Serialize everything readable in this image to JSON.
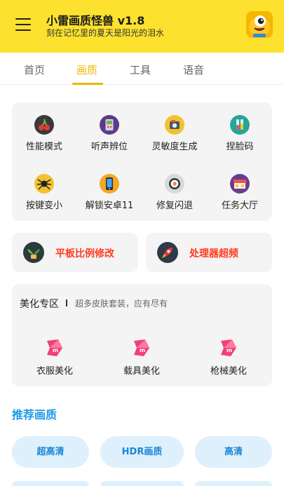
{
  "header": {
    "title": "小雷画质怪兽 v1.8",
    "subtitle": "刻在记忆里的夏天是阳光的泪水"
  },
  "tabs": [
    {
      "label": "首页",
      "active": false
    },
    {
      "label": "画质",
      "active": true
    },
    {
      "label": "工具",
      "active": false
    },
    {
      "label": "语音",
      "active": false
    }
  ],
  "grid": [
    {
      "label": "性能模式",
      "icon": "cherry-icon"
    },
    {
      "label": "听声辨位",
      "icon": "gameboy-icon"
    },
    {
      "label": "灵敏度生成",
      "icon": "camera-icon"
    },
    {
      "label": "捏脸码",
      "icon": "test-tube-icon"
    },
    {
      "label": "按键变小",
      "icon": "spider-icon"
    },
    {
      "label": "解锁安卓11",
      "icon": "phone-icon"
    },
    {
      "label": "修复闪退",
      "icon": "sushi-icon"
    },
    {
      "label": "任务大厅",
      "icon": "stalls-icon"
    }
  ],
  "promos": [
    {
      "label": "平板比例修改",
      "icon": "plant-icon"
    },
    {
      "label": "处理器超频",
      "icon": "rocket-icon"
    }
  ],
  "beauty": {
    "title": "美化专区",
    "subtitle": "超多皮肤套装，应有尽有",
    "items": [
      {
        "label": "衣服美化",
        "icon": "m-logo-icon"
      },
      {
        "label": "载具美化",
        "icon": "m-logo-icon"
      },
      {
        "label": "枪械美化",
        "icon": "m-logo-icon"
      }
    ]
  },
  "recommend": {
    "title": "推荐画质",
    "options": [
      "超高清",
      "HDR画质",
      "高清"
    ]
  },
  "colors": {
    "header_bg": "#fce22e",
    "accent_yellow": "#f0b400",
    "promo_text": "#ff3b1f",
    "section_blue": "#1a9ae8",
    "pill_bg": "#dff0fd"
  }
}
